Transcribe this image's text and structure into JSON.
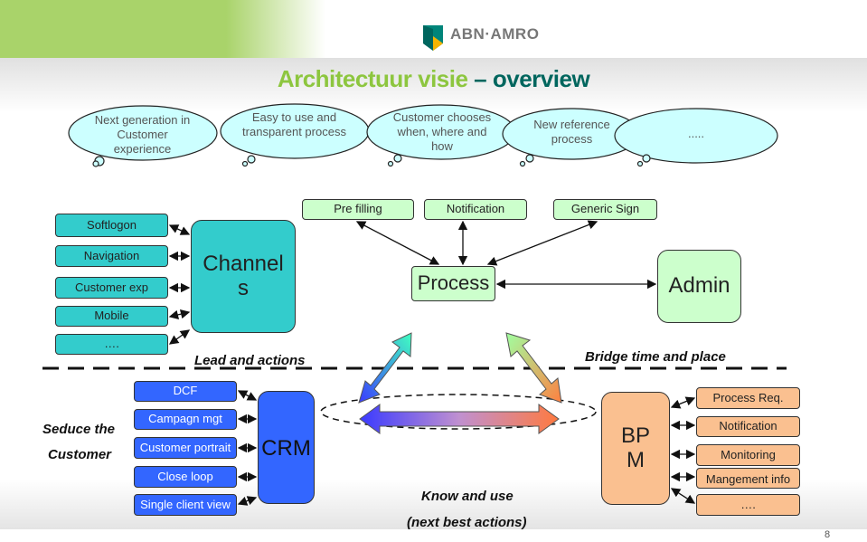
{
  "logo": {
    "text": "ABN·AMRO"
  },
  "title": {
    "part1": "Architectuur visie",
    "dash": " – ",
    "part2": "overview"
  },
  "clouds": [
    "Next generation in Customer experience",
    "Easy to use and transparent process",
    "Customer chooses when, where and how",
    "New  reference process",
    "....."
  ],
  "channels_inputs": [
    "Softlogon",
    "Navigation",
    "Customer exp",
    "Mobile",
    "…."
  ],
  "channels": "Channel s",
  "top_boxes": [
    "Pre filling",
    "Notification",
    "Generic Sign"
  ],
  "process": "Process",
  "admin": "Admin",
  "lead_label": "Lead and actions",
  "bridge_label": "Bridge time and place",
  "seduce": [
    "Seduce the",
    "Customer"
  ],
  "crm_inputs": [
    "DCF",
    "Campagn mgt",
    "Customer portrait",
    "Close loop",
    "Single client view"
  ],
  "crm": "CRM",
  "bpm": "BP M",
  "bpm_outputs": [
    "Process Req.",
    "Notification",
    "Monitoring",
    "Mangement info",
    "…."
  ],
  "know": [
    "Know and use",
    "(next best actions)"
  ],
  "page_number": "8",
  "colors": {
    "green": "#8dc63f",
    "darkgreen": "#00665e",
    "cyan": "#33cccc",
    "lightgreen": "#ccffcc",
    "blue": "#3366ff",
    "orange": "#fac090"
  }
}
